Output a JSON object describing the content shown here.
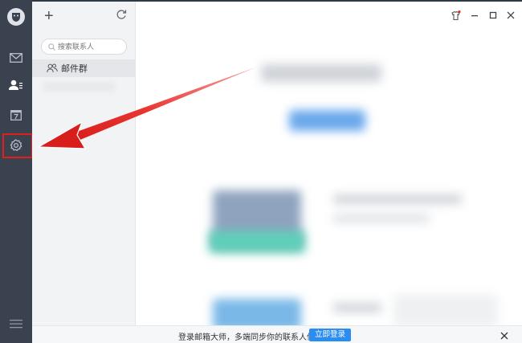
{
  "contacts": {
    "search_placeholder": "搜索联系人",
    "group_label": "邮件群"
  },
  "bottom_bar": {
    "message": "登录邮箱大师，多端同步你的联系人信息",
    "login_button": "立即登录"
  },
  "colors": {
    "rail": "#3a4250",
    "highlight_box": "#e0201c",
    "accent": "#2d8cf0",
    "arrow": "#e0201c"
  },
  "icons": [
    "logo-icon",
    "mail-icon",
    "contacts-icon",
    "calendar-icon",
    "settings-icon",
    "menu-icon",
    "add-icon",
    "refresh-icon",
    "search-icon",
    "group-icon",
    "skin-icon",
    "minimize-icon",
    "maximize-icon",
    "close-icon"
  ]
}
